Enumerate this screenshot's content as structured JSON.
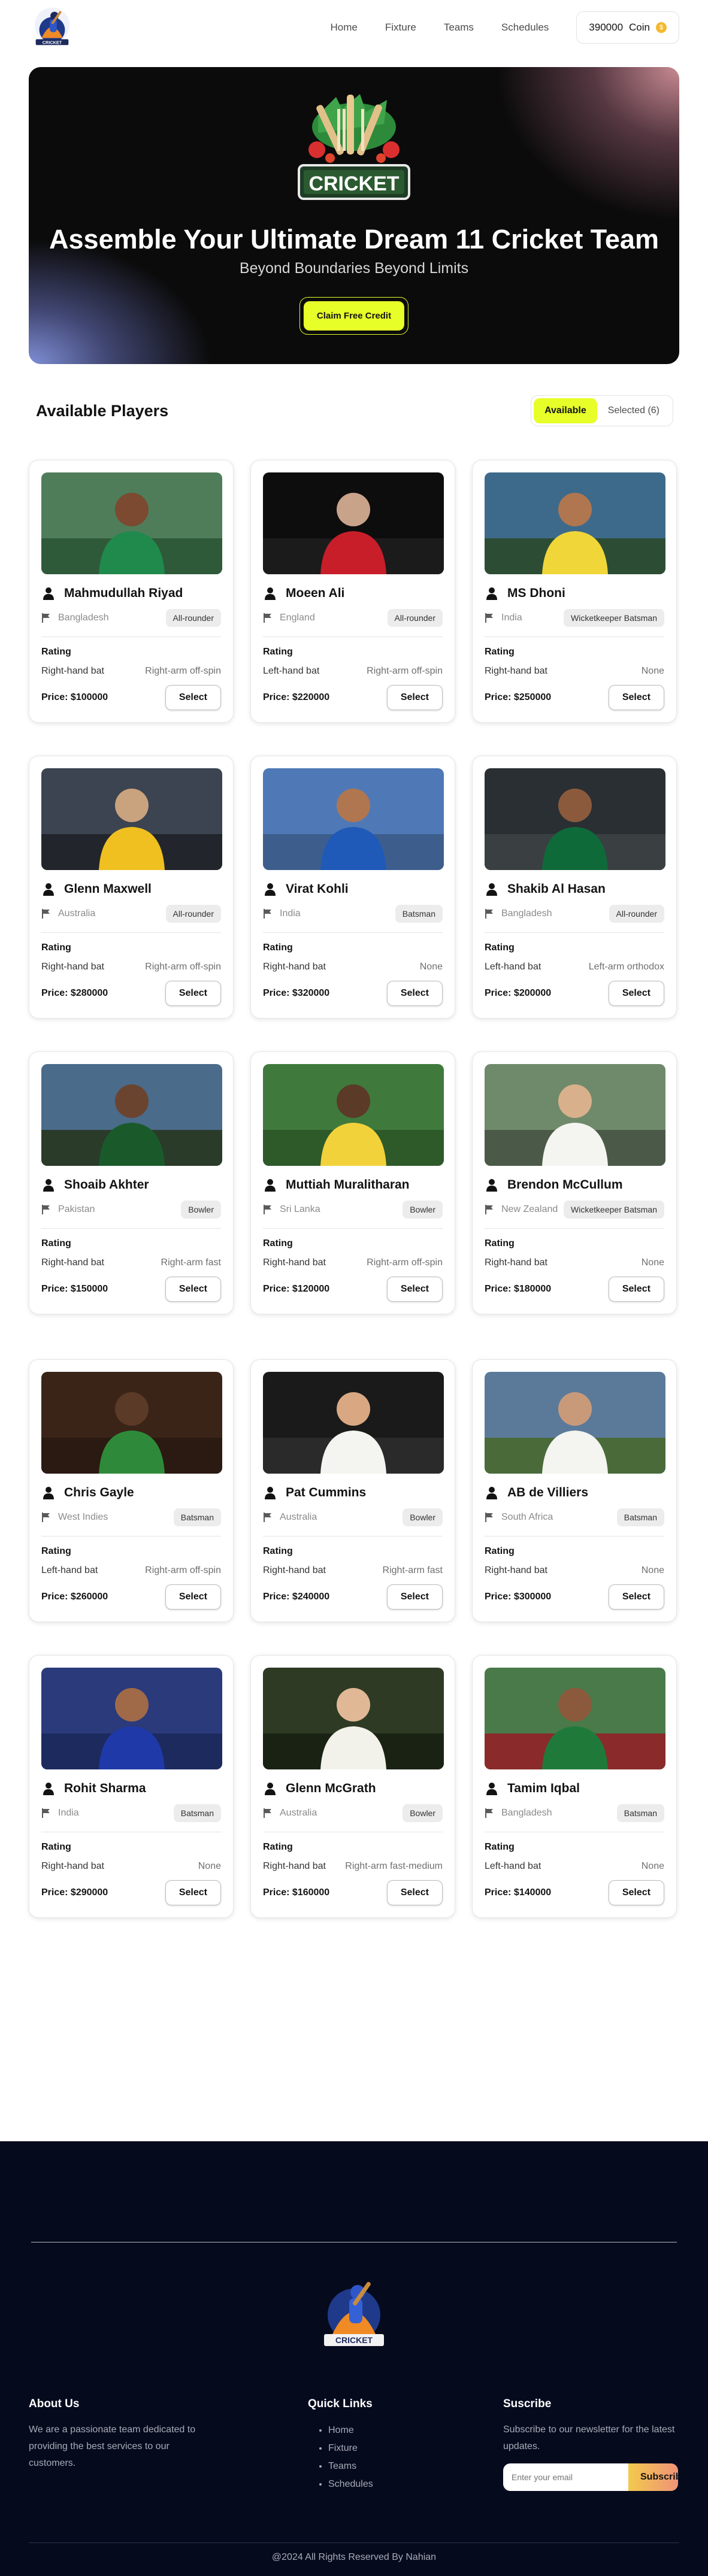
{
  "nav": {
    "links": [
      "Home",
      "Fixture",
      "Teams",
      "Schedules"
    ],
    "coin_amount": "390000",
    "coin_label": "Coin",
    "logo_text": "CRICKET"
  },
  "hero": {
    "banner_text": "CRICKET",
    "title": "Assemble Your Ultimate Dream 11 Cricket Team",
    "subtitle": "Beyond Boundaries Beyond Limits",
    "cta": "Claim Free Credit"
  },
  "section": {
    "title": "Available Players",
    "tab_available": "Available",
    "tab_selected": "Selected (6)"
  },
  "labels": {
    "rating": "Rating",
    "select": "Select"
  },
  "players": [
    {
      "name": "Mahmudullah Riyad",
      "country": "Bangladesh",
      "role": "All-rounder",
      "bat": "Right-hand bat",
      "bowl": "Right-arm off-spin",
      "price": "Price: $100000"
    },
    {
      "name": "Moeen Ali",
      "country": "England",
      "role": "All-rounder",
      "bat": "Left-hand bat",
      "bowl": "Right-arm off-spin",
      "price": "Price: $220000"
    },
    {
      "name": "MS Dhoni",
      "country": "India",
      "role": "Wicketkeeper Batsman",
      "bat": "Right-hand bat",
      "bowl": "None",
      "price": "Price: $250000"
    },
    {
      "name": "Glenn Maxwell",
      "country": "Australia",
      "role": "All-rounder",
      "bat": "Right-hand bat",
      "bowl": "Right-arm off-spin",
      "price": "Price: $280000"
    },
    {
      "name": "Virat Kohli",
      "country": "India",
      "role": "Batsman",
      "bat": "Right-hand bat",
      "bowl": "None",
      "price": "Price: $320000"
    },
    {
      "name": "Shakib Al Hasan",
      "country": "Bangladesh",
      "role": "All-rounder",
      "bat": "Left-hand bat",
      "bowl": "Left-arm orthodox",
      "price": "Price: $200000"
    },
    {
      "name": "Shoaib Akhter",
      "country": "Pakistan",
      "role": "Bowler",
      "bat": "Right-hand bat",
      "bowl": "Right-arm fast",
      "price": "Price: $150000"
    },
    {
      "name": "Muttiah Muralitharan",
      "country": "Sri Lanka",
      "role": "Bowler",
      "bat": "Right-hand bat",
      "bowl": "Right-arm off-spin",
      "price": "Price: $120000"
    },
    {
      "name": "Brendon McCullum",
      "country": "New Zealand",
      "role": "Wicketkeeper Batsman",
      "bat": "Right-hand bat",
      "bowl": "None",
      "price": "Price: $180000"
    },
    {
      "name": "Chris Gayle",
      "country": "West Indies",
      "role": "Batsman",
      "bat": "Left-hand bat",
      "bowl": "Right-arm off-spin",
      "price": "Price: $260000"
    },
    {
      "name": "Pat Cummins",
      "country": "Australia",
      "role": "Bowler",
      "bat": "Right-hand bat",
      "bowl": "Right-arm fast",
      "price": "Price: $240000"
    },
    {
      "name": "AB de Villiers",
      "country": "South Africa",
      "role": "Batsman",
      "bat": "Right-hand bat",
      "bowl": "None",
      "price": "Price: $300000"
    },
    {
      "name": "Rohit Sharma",
      "country": "India",
      "role": "Batsman",
      "bat": "Right-hand bat",
      "bowl": "None",
      "price": "Price: $290000"
    },
    {
      "name": "Glenn McGrath",
      "country": "Australia",
      "role": "Bowler",
      "bat": "Right-hand bat",
      "bowl": "Right-arm fast-medium",
      "price": "Price: $160000"
    },
    {
      "name": "Tamim Iqbal",
      "country": "Bangladesh",
      "role": "Batsman",
      "bat": "Left-hand bat",
      "bowl": "None",
      "price": "Price: $140000"
    }
  ],
  "footer": {
    "logo_text": "CRICKET",
    "about_title": "About Us",
    "about_text": "We are a passionate team dedicated to providing the best services to our customers.",
    "links_title": "Quick Links",
    "links": [
      "Home",
      "Fixture",
      "Teams",
      "Schedules"
    ],
    "subscribe_title": "Suscribe",
    "subscribe_text": "Subscribe to our newsletter for the latest updates.",
    "email_placeholder": "Enter your email",
    "subscribe_button": "Subscribe",
    "copyright": "@2024 All Rights Reserved By Nahian"
  },
  "colors": {
    "accent": "#e7fe29",
    "footer_bg": "#060a1d",
    "hero_bg": "#0b0b0b"
  }
}
